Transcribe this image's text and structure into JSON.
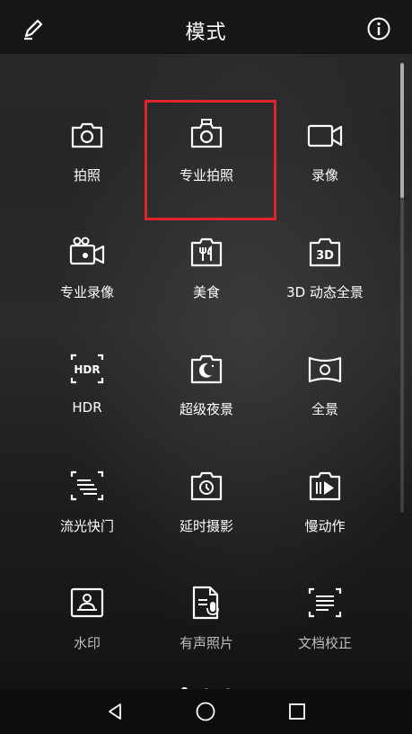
{
  "header": {
    "title": "模式"
  },
  "modes": [
    {
      "label": "拍照",
      "icon": "camera-icon"
    },
    {
      "label": "专业拍照",
      "icon": "pro-camera-icon"
    },
    {
      "label": "录像",
      "icon": "video-icon"
    },
    {
      "label": "专业录像",
      "icon": "pro-video-icon"
    },
    {
      "label": "美食",
      "icon": "food-icon"
    },
    {
      "label": "3D 动态全景",
      "icon": "3d-icon"
    },
    {
      "label": "HDR",
      "icon": "hdr-icon"
    },
    {
      "label": "超级夜景",
      "icon": "night-icon"
    },
    {
      "label": "全景",
      "icon": "panorama-icon"
    },
    {
      "label": "流光快门",
      "icon": "light-painting-icon"
    },
    {
      "label": "延时摄影",
      "icon": "timelapse-icon"
    },
    {
      "label": "慢动作",
      "icon": "slow-motion-icon"
    },
    {
      "label": "水印",
      "icon": "watermark-icon"
    },
    {
      "label": "有声照片",
      "icon": "audio-photo-icon"
    },
    {
      "label": "文档校正",
      "icon": "document-icon"
    }
  ],
  "page_indicator": {
    "pages": 3,
    "current": 1
  },
  "colors": {
    "highlight": "#e0242b"
  }
}
